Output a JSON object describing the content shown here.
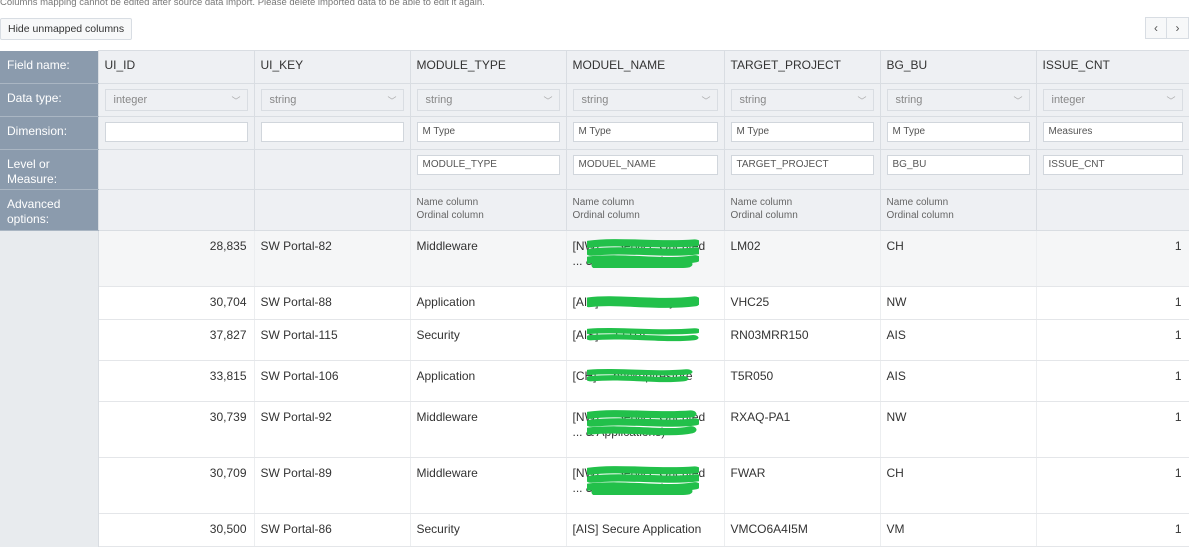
{
  "notice": "Columns mapping cannot be edited after source data import. Please delete imported data to be able to edit it again.",
  "hide_button": "Hide unmapped columns",
  "pager": {
    "prev_icon": "‹",
    "next_icon": "›"
  },
  "row_labels": {
    "field_name": "Field name:",
    "data_type": "Data type:",
    "dimension": "Dimension:",
    "level": "Level or Measure:",
    "advanced": "Advanced options:"
  },
  "columns": [
    {
      "name": "UI_ID",
      "type": "integer",
      "dimension": "",
      "level": "",
      "adv1": "",
      "adv2": ""
    },
    {
      "name": "UI_KEY",
      "type": "string",
      "dimension": "",
      "level": "",
      "adv1": "",
      "adv2": ""
    },
    {
      "name": "MODULE_TYPE",
      "type": "string",
      "dimension": "M Type",
      "level": "MODULE_TYPE",
      "adv1": "Name column",
      "adv2": "Ordinal column"
    },
    {
      "name": "MODUEL_NAME",
      "type": "string",
      "dimension": "M Type",
      "level": "MODUEL_NAME",
      "adv1": "Name column",
      "adv2": "Ordinal column"
    },
    {
      "name": "TARGET_PROJECT",
      "type": "string",
      "dimension": "M Type",
      "level": "TARGET_PROJECT",
      "adv1": "Name column",
      "adv2": "Ordinal column"
    },
    {
      "name": "BG_BU",
      "type": "string",
      "dimension": "M Type",
      "level": "BG_BU",
      "adv1": "Name column",
      "adv2": "Ordinal column"
    },
    {
      "name": "ISSUE_CNT",
      "type": "integer",
      "dimension": "Measures",
      "level": "ISSUE_CNT",
      "adv1": "",
      "adv2": ""
    }
  ],
  "rows": [
    {
      "ui_id": "28,835",
      "ui_key": "SW Portal-82",
      "module_type": "Middleware",
      "moduel_name": "[NW] ... Service Oriented ... & Applications)",
      "target": "LM02",
      "bg_bu": "CH",
      "issue_cnt": "1"
    },
    {
      "ui_id": "30,704",
      "ui_key": "SW Portal-88",
      "module_type": "Application",
      "moduel_name": "[AIS] DLMS Library",
      "target": "VHC25",
      "bg_bu": "NW",
      "issue_cnt": "1"
    },
    {
      "ui_id": "37,827",
      "ui_key": "SW Portal-115",
      "module_type": "Security",
      "moduel_name": "[AIS] ... FOTA",
      "target": "RN03MRR150",
      "bg_bu": "AIS",
      "issue_cnt": "1"
    },
    {
      "ui_id": "33,815",
      "ui_key": "SW Portal-106",
      "module_type": "Application",
      "moduel_name": "[CH] ... backup/restore",
      "target": "T5R050",
      "bg_bu": "AIS",
      "issue_cnt": "1"
    },
    {
      "ui_id": "30,739",
      "ui_key": "SW Portal-92",
      "module_type": "Middleware",
      "moduel_name": "[NW] ... Service Oriented ... & Applications)",
      "target": "RXAQ-PA1",
      "bg_bu": "NW",
      "issue_cnt": "1"
    },
    {
      "ui_id": "30,709",
      "ui_key": "SW Portal-89",
      "module_type": "Middleware",
      "moduel_name": "[NW] ... Service Oriented ... & Applications)",
      "target": "FWAR",
      "bg_bu": "CH",
      "issue_cnt": "1"
    },
    {
      "ui_id": "30,500",
      "ui_key": "SW Portal-86",
      "module_type": "Security",
      "moduel_name": "[AIS] Secure Application",
      "target": "VMCO6A4I5M",
      "bg_bu": "VM",
      "issue_cnt": "1"
    }
  ],
  "colors": {
    "row_header_bg": "#8b9bad",
    "header_cell_bg": "#eef0f3",
    "redaction": "#22c04a"
  }
}
